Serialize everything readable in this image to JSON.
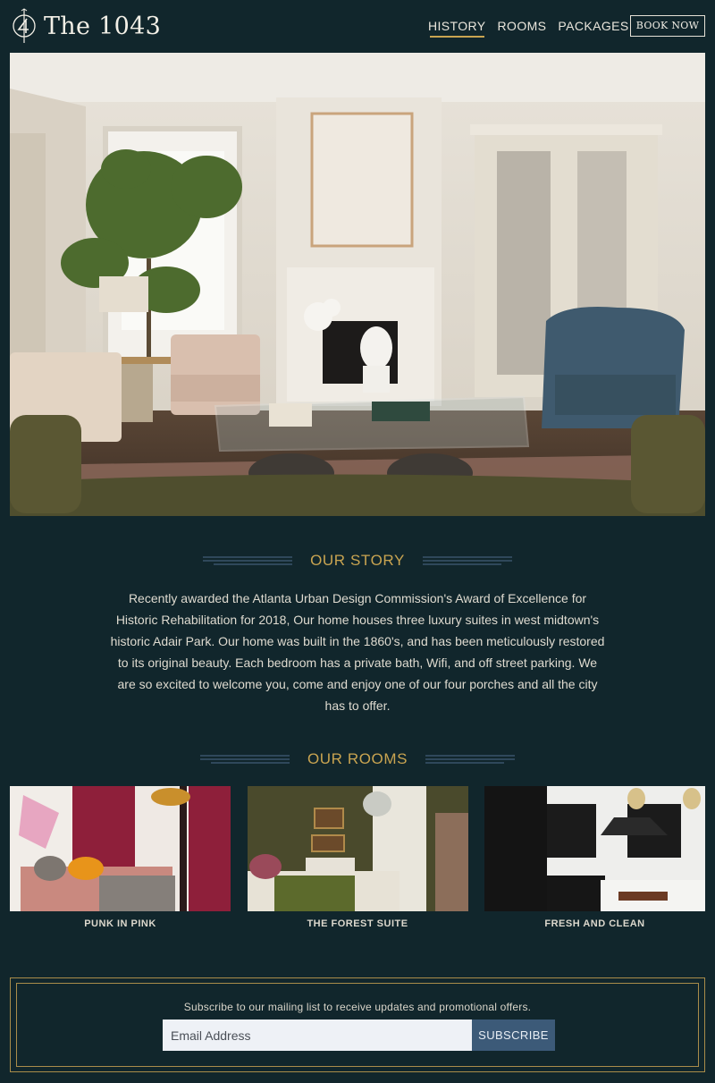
{
  "brand": {
    "name": "The 1043",
    "logo_icon": "compass-four-logo-icon"
  },
  "nav": {
    "items": [
      {
        "label": "HISTORY",
        "active": true
      },
      {
        "label": "ROOMS",
        "active": false
      },
      {
        "label": "PACKAGES",
        "active": false
      }
    ],
    "book_label": "BOOK NOW"
  },
  "story": {
    "title": "OUR STORY",
    "text": "Recently awarded the Atlanta Urban Design Commission's Award of Excellence for Historic Rehabilitation for 2018, Our home houses three luxury suites in west midtown's historic Adair Park. Our home was built in the 1860's, and has been meticulously restored to its original beauty. Each bedroom has a private bath, Wifi, and off street parking. We are so excited to welcome you, come and enjoy one of our four porches and all the city has to offer."
  },
  "rooms": {
    "title": "OUR ROOMS",
    "items": [
      {
        "name": "PUNK IN PINK"
      },
      {
        "name": "THE FOREST SUITE"
      },
      {
        "name": "FRESH AND CLEAN"
      }
    ]
  },
  "subscribe": {
    "message": "Subscribe to our mailing list to receive updates and promotional offers.",
    "placeholder": "Email Address",
    "button_label": "SUBSCRIBE"
  },
  "colors": {
    "background": "#11262c",
    "accent_gold": "#c9a451",
    "button_blue": "#3c5a78"
  }
}
